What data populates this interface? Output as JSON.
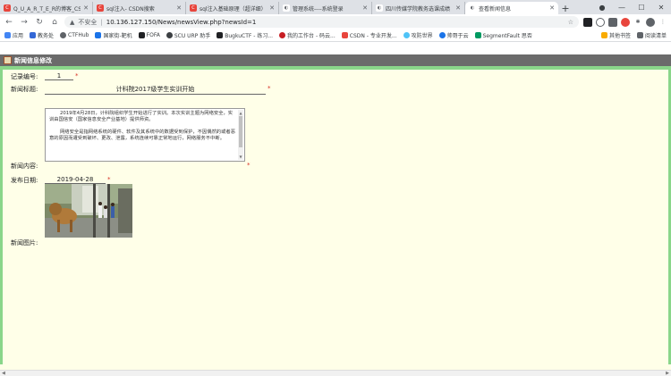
{
  "tabs": [
    {
      "title": "Q_U_A_R_T_E_R的博客_CS",
      "icon_color": "#e8453c",
      "icon_text": "C"
    },
    {
      "title": "sql注入- CSDN搜索",
      "icon_color": "#e8453c",
      "icon_text": "C"
    },
    {
      "title": "sql注入基础原理（超详细）",
      "icon_color": "#e8453c",
      "icon_text": "C"
    },
    {
      "title": "管理系统----系统登录",
      "icon_color": "#5f6368",
      "icon_text": "◐"
    },
    {
      "title": "四川传媒学院教务选课成绩",
      "icon_color": "#5f6368",
      "icon_text": "◐"
    },
    {
      "title": "查看新闻信息",
      "icon_color": "#5f6368",
      "icon_text": "◐",
      "active": true
    }
  ],
  "address": {
    "security": "不安全",
    "url": "10.136.127.150/News/newsView.php?newsId=1"
  },
  "bookmarks": [
    "应用",
    "教务处",
    "CTFHub",
    "国家街-靶机",
    "FOFA",
    "SCU URP 助手",
    "BugkuCTF - 练习...",
    "我的工作台 - 码云...",
    "CSDN - 专业开发...",
    "攻防世界",
    "帅哥于云",
    "SegmentFault 思否"
  ],
  "bookmarks_right": [
    "其他书签",
    "阅读清单"
  ],
  "header": {
    "title": "新闻信息修改"
  },
  "form": {
    "id_label": "记录编号:",
    "id_value": "1",
    "title_label": "新闻标题:",
    "title_value": "计科院2017级学生实训开始",
    "content_label": "新闻内容:",
    "content_p1": "2019年4月28日，计科院组织学生开始进行了实训。本次实训主题为网络安全，实训由国信安（国家信息安全产业基地）提供师资。",
    "content_p2": "网络安全是指网络系统的硬件、软件及其系统中的数据受到保护，不因偶然的或者恶意的原因而遭受到破坏、更改、泄露，系统连续可靠正常地运行，网络服务不中断。",
    "date_label": "发布日期:",
    "date_value": "2019-04-28",
    "image_label": "新闻图片:",
    "required_mark": "*"
  },
  "colors": {
    "header_bg": "#6b6b6b",
    "accent_green": "#8ad68a",
    "page_bg": "#ffffe8",
    "required": "#d93025"
  }
}
